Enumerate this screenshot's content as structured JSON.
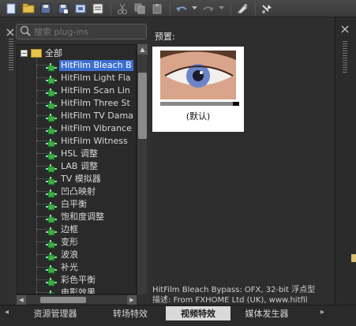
{
  "search": {
    "placeholder": "搜索 plug-ins"
  },
  "tree": {
    "root_label": "全部",
    "expander": "−",
    "items": [
      {
        "label": "HitFilm Bleach B",
        "selected": true
      },
      {
        "label": "HitFilm Light Fla"
      },
      {
        "label": "HitFilm Scan Lin"
      },
      {
        "label": "HitFilm Three St"
      },
      {
        "label": "HitFilm TV Dama"
      },
      {
        "label": "HitFilm Vibrance"
      },
      {
        "label": "HitFilm Witness"
      },
      {
        "label": "HSL 调整"
      },
      {
        "label": "LAB 调整"
      },
      {
        "label": "TV 模拟器"
      },
      {
        "label": "凹凸映射"
      },
      {
        "label": "白平衡"
      },
      {
        "label": "饱和度调整"
      },
      {
        "label": "边框"
      },
      {
        "label": "变形"
      },
      {
        "label": "波浪"
      },
      {
        "label": "补光"
      },
      {
        "label": "彩色平衡"
      },
      {
        "label": "电影效果"
      }
    ]
  },
  "preview": {
    "title": "预置:",
    "preset_caption": "(默认)",
    "description_line1": "HitFilm Bleach Bypass: OFX, 32-bit 浮点型",
    "description_line2": "描述: From FXHOME Ltd (UK), www.hitfil"
  },
  "tabs": [
    {
      "label": "资源管理器",
      "active": false
    },
    {
      "label": "转场特效",
      "active": false
    },
    {
      "label": "视频特效",
      "active": true
    },
    {
      "label": "媒体发生器",
      "active": false
    }
  ],
  "tab_arrows": {
    "left": "◂",
    "right": "▸"
  },
  "colors": {
    "selection": "#3b6fd0",
    "folder": "#e8c44a",
    "plugin_icon": "#3cb043"
  }
}
